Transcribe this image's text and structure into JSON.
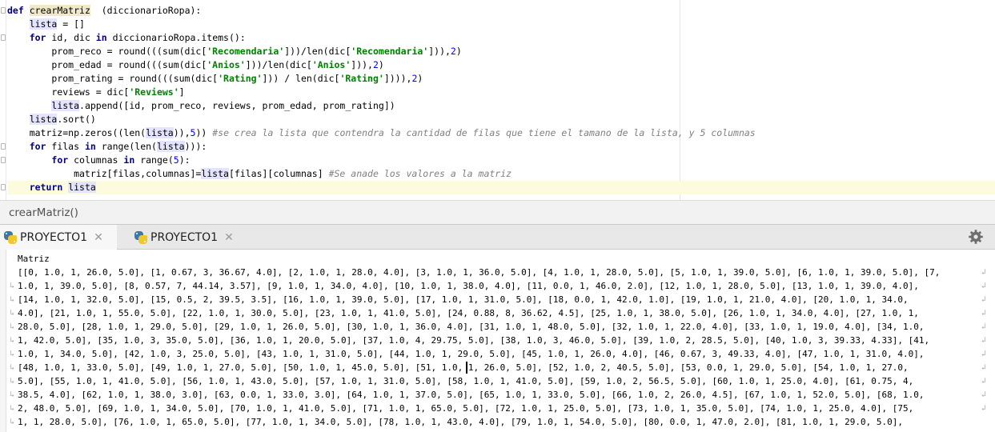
{
  "editor": {
    "lines": [
      {
        "tokens": [
          [
            "kw",
            "def "
          ],
          [
            "hl-def",
            "crearMatriz"
          ],
          [
            "",
            "  (diccionarioRopa):"
          ]
        ]
      },
      {
        "tokens": [
          [
            "",
            "    "
          ],
          [
            "hl-var",
            "lista"
          ],
          [
            "",
            " = []"
          ]
        ]
      },
      {
        "tokens": [
          [
            "",
            "    "
          ],
          [
            "kw",
            "for"
          ],
          [
            "",
            " id, dic "
          ],
          [
            "kw",
            "in"
          ],
          [
            "",
            " diccionarioRopa.items():"
          ]
        ]
      },
      {
        "tokens": [
          [
            "",
            "        prom_reco = round(((sum(dic["
          ],
          [
            "str",
            "'Recomendaria'"
          ],
          [
            "",
            "]))/len(dic["
          ],
          [
            "str",
            "'Recomendaria'"
          ],
          [
            "",
            "])),"
          ],
          [
            "num",
            "2"
          ],
          [
            "",
            ")"
          ]
        ]
      },
      {
        "tokens": [
          [
            "",
            "        prom_edad = round(((sum(dic["
          ],
          [
            "str",
            "'Anios'"
          ],
          [
            "",
            "]))/len(dic["
          ],
          [
            "str",
            "'Anios'"
          ],
          [
            "",
            "])),"
          ],
          [
            "num",
            "2"
          ],
          [
            "",
            ")"
          ]
        ]
      },
      {
        "tokens": [
          [
            "",
            "        prom_rating = round(((sum(dic["
          ],
          [
            "str",
            "'Rating'"
          ],
          [
            "",
            "])) / len(dic["
          ],
          [
            "str",
            "'Rating'"
          ],
          [
            "",
            "]))),"
          ],
          [
            "num",
            "2"
          ],
          [
            "",
            ")"
          ]
        ]
      },
      {
        "tokens": [
          [
            "",
            "        reviews = dic["
          ],
          [
            "str",
            "'Reviews'"
          ],
          [
            "",
            "]"
          ]
        ]
      },
      {
        "tokens": [
          [
            "",
            "        "
          ],
          [
            "hl-var",
            "lista"
          ],
          [
            "",
            ".append([id, prom_reco, reviews, prom_edad, prom_rating])"
          ]
        ]
      },
      {
        "tokens": [
          [
            "",
            "    "
          ],
          [
            "hl-var",
            "lista"
          ],
          [
            "",
            ".sort()"
          ]
        ]
      },
      {
        "tokens": [
          [
            "",
            "    matriz=np.zeros((len("
          ],
          [
            "hl-var",
            "lista"
          ],
          [
            "",
            ")),"
          ],
          [
            "num",
            "5"
          ],
          [
            "",
            ")) "
          ],
          [
            "cmt",
            "#se crea la lista que contendra la cantidad de filas que tiene el tamano de la lista, y 5 columnas"
          ]
        ]
      },
      {
        "tokens": [
          [
            "",
            "    "
          ],
          [
            "kw",
            "for"
          ],
          [
            "",
            " filas "
          ],
          [
            "kw",
            "in"
          ],
          [
            "",
            " range(len("
          ],
          [
            "hl-var",
            "lista"
          ],
          [
            "",
            "))):"
          ]
        ]
      },
      {
        "tokens": [
          [
            "",
            "        "
          ],
          [
            "kw",
            "for"
          ],
          [
            "",
            " columnas "
          ],
          [
            "kw",
            "in"
          ],
          [
            "",
            " range("
          ],
          [
            "num",
            "5"
          ],
          [
            "",
            "):"
          ]
        ]
      },
      {
        "tokens": [
          [
            "",
            "            matriz[filas,columnas]="
          ],
          [
            "hl-var",
            "lista"
          ],
          [
            "",
            "[filas][columnas] "
          ],
          [
            "cmt",
            "#Se anade los valores a la matriz"
          ]
        ]
      },
      {
        "tokens": [
          [
            "",
            "    "
          ],
          [
            "kw",
            "return"
          ],
          [
            "",
            " "
          ],
          [
            "hl-var",
            "lista"
          ]
        ]
      }
    ]
  },
  "breadcrumb": {
    "text": "crearMatriz()"
  },
  "run_tabs": [
    {
      "label": "PROYECTO1",
      "close": "✕",
      "active": true
    },
    {
      "label": "PROYECTO1",
      "close": "✕",
      "active": false
    }
  ],
  "console": {
    "lines": [
      "Matriz",
      "[[0, 1.0, 1, 26.0, 5.0], [1, 0.67, 3, 36.67, 4.0], [2, 1.0, 1, 28.0, 4.0], [3, 1.0, 1, 36.0, 5.0], [4, 1.0, 1, 28.0, 5.0], [5, 1.0, 1, 39.0, 5.0], [6, 1.0, 1, 39.0, 5.0], [7,",
      "1.0, 1, 39.0, 5.0], [8, 0.57, 7, 44.14, 3.57], [9, 1.0, 1, 34.0, 4.0], [10, 1.0, 1, 38.0, 4.0], [11, 0.0, 1, 46.0, 2.0], [12, 1.0, 1, 28.0, 5.0], [13, 1.0, 1, 39.0, 4.0],",
      "[14, 1.0, 1, 32.0, 5.0], [15, 0.5, 2, 39.5, 3.5], [16, 1.0, 1, 39.0, 5.0], [17, 1.0, 1, 31.0, 5.0], [18, 0.0, 1, 42.0, 1.0], [19, 1.0, 1, 21.0, 4.0], [20, 1.0, 1, 34.0,",
      "4.0], [21, 1.0, 1, 55.0, 5.0], [22, 1.0, 1, 30.0, 5.0], [23, 1.0, 1, 41.0, 5.0], [24, 0.88, 8, 36.62, 4.5], [25, 1.0, 1, 38.0, 5.0], [26, 1.0, 1, 34.0, 4.0], [27, 1.0, 1,",
      "28.0, 5.0], [28, 1.0, 1, 29.0, 5.0], [29, 1.0, 1, 26.0, 5.0], [30, 1.0, 1, 36.0, 4.0], [31, 1.0, 1, 48.0, 5.0], [32, 1.0, 1, 22.0, 4.0], [33, 1.0, 1, 19.0, 4.0], [34, 1.0,",
      "1, 42.0, 5.0], [35, 1.0, 3, 35.0, 5.0], [36, 1.0, 1, 20.0, 5.0], [37, 1.0, 4, 29.75, 5.0], [38, 1.0, 3, 46.0, 5.0], [39, 1.0, 2, 28.5, 5.0], [40, 1.0, 3, 39.33, 4.33], [41,",
      "1.0, 1, 34.0, 5.0], [42, 1.0, 3, 25.0, 5.0], [43, 1.0, 1, 31.0, 5.0], [44, 1.0, 1, 29.0, 5.0], [45, 1.0, 1, 26.0, 4.0], [46, 0.67, 3, 49.33, 4.0], [47, 1.0, 1, 31.0, 4.0],",
      "[48, 1.0, 1, 33.0, 5.0], [49, 1.0, 1, 27.0, 5.0], [50, 1.0, 1, 45.0, 5.0], [51, 1.0, 1, 26.0, 5.0], [52, 1.0, 2, 40.5, 5.0], [53, 0.0, 1, 29.0, 5.0], [54, 1.0, 1, 27.0,",
      "5.0], [55, 1.0, 1, 41.0, 5.0], [56, 1.0, 1, 43.0, 5.0], [57, 1.0, 1, 31.0, 5.0], [58, 1.0, 1, 41.0, 5.0], [59, 1.0, 2, 56.5, 5.0], [60, 1.0, 1, 25.0, 4.0], [61, 0.75, 4,",
      "38.5, 4.0], [62, 1.0, 1, 38.0, 3.0], [63, 0.0, 1, 33.0, 3.0], [64, 1.0, 1, 37.0, 5.0], [65, 1.0, 1, 33.0, 5.0], [66, 1.0, 2, 26.0, 4.5], [67, 1.0, 1, 52.0, 5.0], [68, 1.0,",
      "2, 48.0, 5.0], [69, 1.0, 1, 34.0, 5.0], [70, 1.0, 1, 41.0, 5.0], [71, 1.0, 1, 65.0, 5.0], [72, 1.0, 1, 25.0, 5.0], [73, 1.0, 1, 35.0, 5.0], [74, 1.0, 1, 25.0, 4.0], [75,",
      "1, 1, 28.0, 5.0], [76, 1.0, 1, 65.0, 5.0], [77, 1.0, 1, 34.0, 5.0], [78, 1.0, 1, 43.0, 4.0], [79, 1.0, 1, 54.0, 5.0], [80, 0.0, 1, 47.0, 2.0], [81, 1.0, 1, 29.0, 5.0],"
    ]
  },
  "icons": {
    "tab": "python-icon",
    "settings": "gear-icon",
    "wrap": "soft-wrap-icon"
  }
}
